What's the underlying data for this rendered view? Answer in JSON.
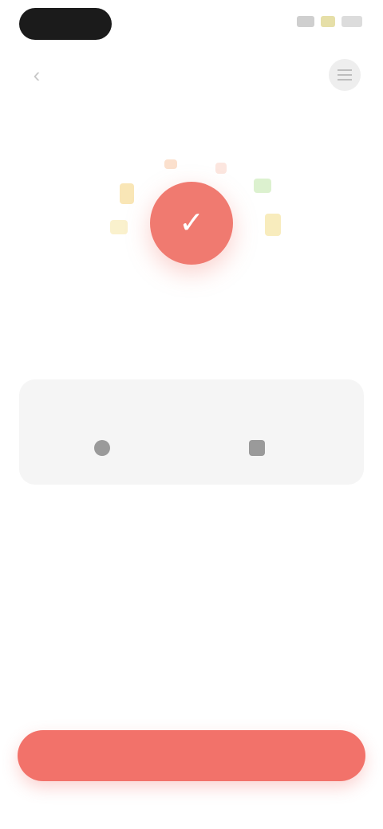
{
  "status_bar": {
    "signal_icon": "signal-icon",
    "wifi_icon": "wifi-icon",
    "battery_icon": "battery-icon"
  },
  "nav": {
    "back_icon": "chevron-left-icon",
    "back_glyph": "‹",
    "menu_icon": "menu-icon"
  },
  "hero": {
    "icon": "check-icon",
    "icon_glyph": "✓",
    "color": "#f07a70"
  },
  "title": "",
  "subtitle": "",
  "card": {
    "heading": "",
    "stats": [
      {
        "icon": "clock-icon",
        "value": ""
      },
      {
        "icon": "calendar-icon",
        "value": ""
      }
    ]
  },
  "primary_button": {
    "label": "",
    "color": "#f2726a"
  }
}
